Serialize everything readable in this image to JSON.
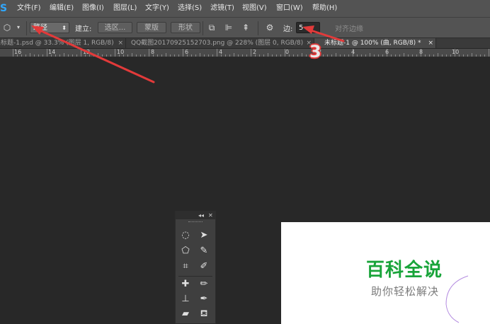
{
  "app": {
    "logo": "S"
  },
  "menu": [
    {
      "label": "文件(F)"
    },
    {
      "label": "编辑(E)"
    },
    {
      "label": "图像(I)"
    },
    {
      "label": "图层(L)"
    },
    {
      "label": "文字(Y)"
    },
    {
      "label": "选择(S)"
    },
    {
      "label": "滤镜(T)"
    },
    {
      "label": "视图(V)"
    },
    {
      "label": "窗口(W)"
    },
    {
      "label": "帮助(H)"
    }
  ],
  "options": {
    "tool_icon": "polygon-tool-icon",
    "mode_value": "路径",
    "make_label": "建立:",
    "selection_btn": "选区...",
    "mask_btn": "蒙版",
    "shape_btn": "形状",
    "sides_label": "边:",
    "sides_value": "5",
    "align_edges_label": "对齐边缘"
  },
  "tabs": [
    {
      "label": "未标题-1.psd @ 33.3% (图层 1, RGB/8)",
      "close": "×"
    },
    {
      "label": "QQ截图20170925152703.png @ 228% (图层 0, RGB/8)",
      "close": "×"
    },
    {
      "label": "未标题-1 @ 100% (曲, RGB/8) *",
      "close": "×",
      "active": true
    }
  ],
  "ruler": [
    "16",
    "14",
    "12",
    "10",
    "8",
    "6",
    "4",
    "2",
    "0",
    "2",
    "4",
    "6",
    "8",
    "10"
  ],
  "annotation": {
    "step": "3"
  },
  "watermark": {
    "title": "百科全说",
    "subtitle": "助你轻松解决"
  },
  "colors": {
    "accent_red": "#e23a3a",
    "brand_green": "#19a43a",
    "ps_blue": "#31a8ff"
  }
}
